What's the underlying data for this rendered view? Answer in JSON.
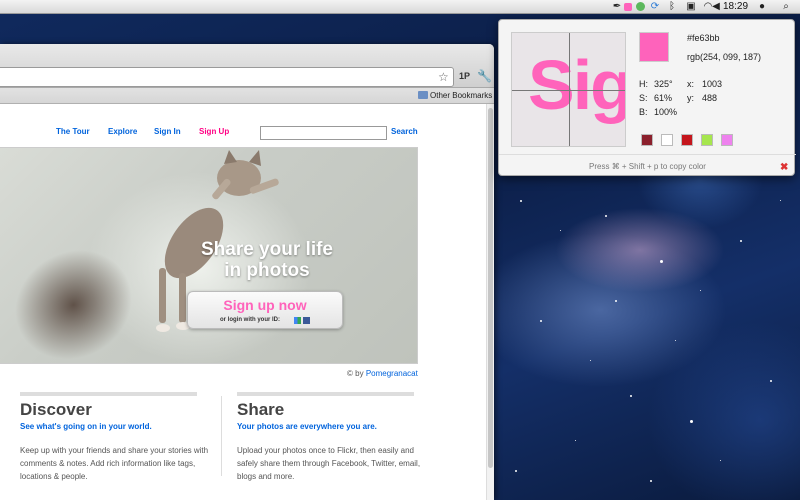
{
  "menubar": {
    "clock": "18:29",
    "icons": [
      "eyedropper-icon",
      "color-icon",
      "evernote-icon",
      "sync-icon",
      "bluetooth-icon",
      "display-icon",
      "wifi-icon",
      "volume-icon",
      "user-icon",
      "spotlight-icon"
    ]
  },
  "browser": {
    "bookmarks": {
      "other_label": "Other Bookmarks"
    },
    "toolbar": {
      "onepassword_label": "1P"
    }
  },
  "flickr": {
    "nav": {
      "tour": "The Tour",
      "explore": "Explore",
      "signin": "Sign In",
      "signup": "Sign Up"
    },
    "search": {
      "button": "Search",
      "value": ""
    },
    "hero": {
      "headline_line1": "Share your life",
      "headline_line2": "in photos",
      "cta": "Sign up now",
      "cta_sub": "or login with your ID:"
    },
    "credit": {
      "prefix": "© by",
      "author": "Pomegranacat"
    },
    "discover": {
      "title": "Discover",
      "subtitle": "See what's going on in your world.",
      "body": "Keep up with your friends and share your stories with comments & notes. Add rich information like tags, locations & people."
    },
    "share": {
      "title": "Share",
      "subtitle": "Your photos are everywhere you are.",
      "body": "Upload your photos once to Flickr, then easily and safely share them through Facebook, Twitter, email, blogs and more."
    }
  },
  "picker": {
    "hex": "#fe63bb",
    "rgb": "rgb(254, 099, 187)",
    "h_label": "H:",
    "h_value": "325°",
    "s_label": "S:",
    "s_value": "61%",
    "b_label": "B:",
    "b_value": "100%",
    "x_label": "x:",
    "x_value": "1003",
    "y_label": "y:",
    "y_value": "488",
    "magnified_text": "Sig",
    "swatches": [
      "#8b1f2c",
      "#ffffff",
      "#c4151c",
      "#a6e64e",
      "#ee82ee"
    ],
    "hint": "Press ⌘ + Shift + p to copy color",
    "close_glyph": "✖"
  }
}
